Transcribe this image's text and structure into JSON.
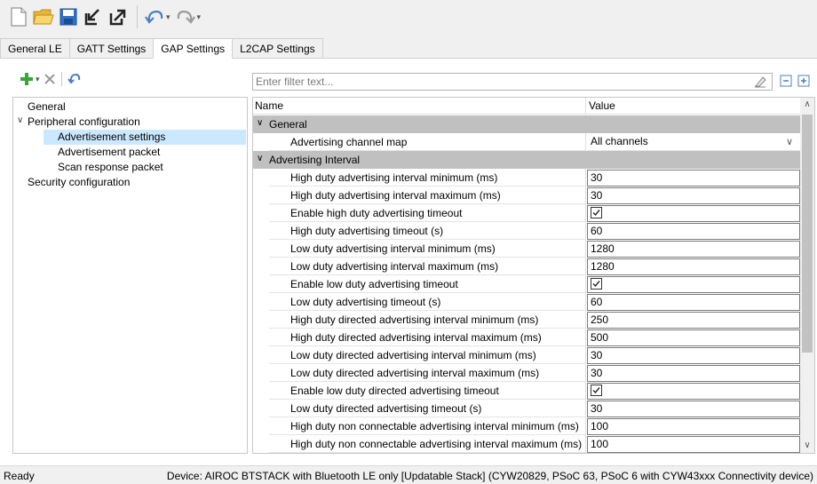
{
  "toolbar": {
    "icons": [
      "new-file-icon",
      "open-folder-icon",
      "save-icon",
      "import-icon",
      "export-icon",
      "undo-icon",
      "redo-icon"
    ]
  },
  "tabs": [
    {
      "label": "General LE",
      "active": false
    },
    {
      "label": "GATT Settings",
      "active": false
    },
    {
      "label": "GAP Settings",
      "active": true
    },
    {
      "label": "L2CAP Settings",
      "active": false
    }
  ],
  "tree": {
    "items": [
      {
        "label": "General",
        "level": 0
      },
      {
        "label": "Peripheral configuration",
        "level": 0,
        "expanded": true
      },
      {
        "label": "Advertisement settings",
        "level": 2,
        "selected": true
      },
      {
        "label": "Advertisement packet",
        "level": 2
      },
      {
        "label": "Scan response packet",
        "level": 2
      },
      {
        "label": "Security configuration",
        "level": 0
      }
    ]
  },
  "filter": {
    "placeholder": "Enter filter text..."
  },
  "grid": {
    "col_name": "Name",
    "col_value": "Value",
    "rows": [
      {
        "type": "category",
        "label": "General"
      },
      {
        "type": "combo",
        "label": "Advertising channel map",
        "value": "All channels"
      },
      {
        "type": "category",
        "label": "Advertising Interval"
      },
      {
        "type": "text",
        "label": "High duty advertising interval minimum (ms)",
        "value": "30"
      },
      {
        "type": "text",
        "label": "High duty advertising interval maximum (ms)",
        "value": "30"
      },
      {
        "type": "check",
        "label": "Enable high duty advertising timeout",
        "checked": true
      },
      {
        "type": "text",
        "label": "High duty advertising timeout (s)",
        "value": "60"
      },
      {
        "type": "text",
        "label": "Low duty advertising interval minimum (ms)",
        "value": "1280"
      },
      {
        "type": "text",
        "label": "Low duty advertising interval maximum (ms)",
        "value": "1280"
      },
      {
        "type": "check",
        "label": "Enable low duty advertising timeout",
        "checked": true
      },
      {
        "type": "text",
        "label": "Low duty advertising timeout (s)",
        "value": "60"
      },
      {
        "type": "text",
        "label": "High duty directed advertising interval minimum (ms)",
        "value": "250"
      },
      {
        "type": "text",
        "label": "High duty directed advertising interval maximum (ms)",
        "value": "500"
      },
      {
        "type": "text",
        "label": "Low duty directed advertising interval minimum (ms)",
        "value": "30"
      },
      {
        "type": "text",
        "label": "Low duty directed advertising interval maximum (ms)",
        "value": "30"
      },
      {
        "type": "check",
        "label": "Enable low duty directed advertising timeout",
        "checked": true
      },
      {
        "type": "text",
        "label": "Low duty directed advertising timeout (s)",
        "value": "30"
      },
      {
        "type": "text",
        "label": "High duty non connectable advertising interval minimum (ms)",
        "value": "100"
      },
      {
        "type": "text",
        "label": "High duty non connectable advertising interval maximum (ms)",
        "value": "100"
      }
    ]
  },
  "status": {
    "ready": "Ready",
    "device": "Device: AIROC BTSTACK with Bluetooth LE only [Updatable Stack] (CYW20829, PSoC 63, PSoC 6 with CYW43xxx Connectivity device)"
  }
}
